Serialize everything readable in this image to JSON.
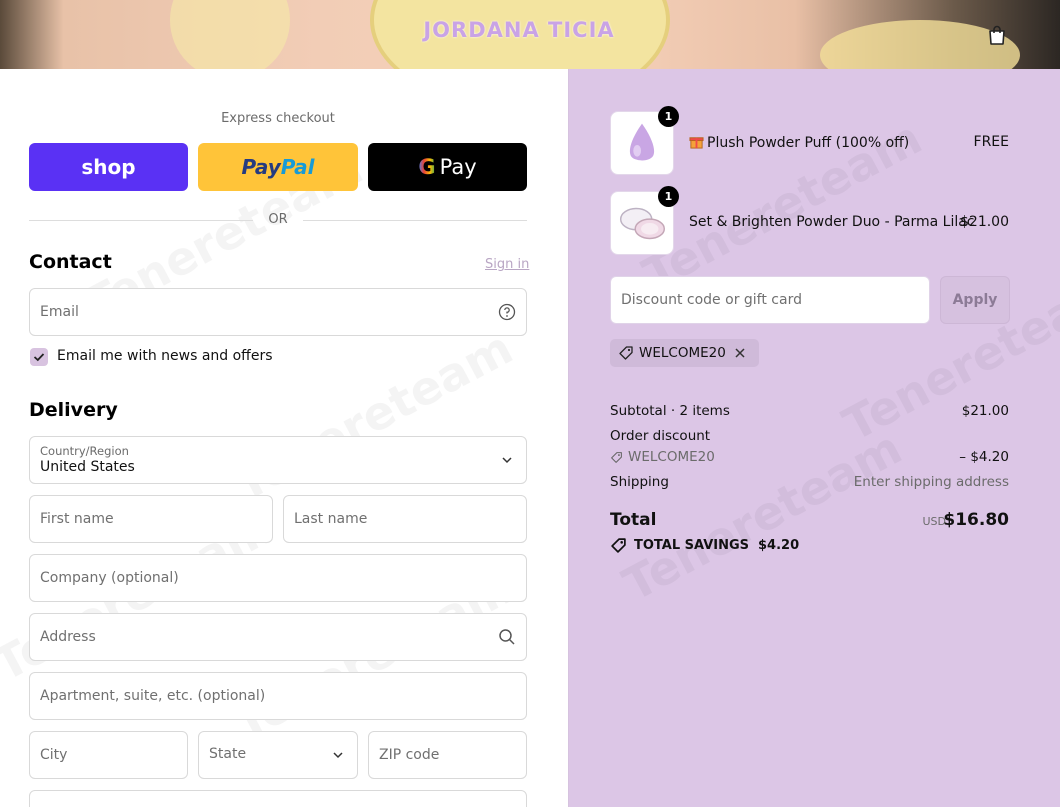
{
  "header": {
    "logo_text": "JORDANA TICIA",
    "cart_icon": "shopping-bag-icon"
  },
  "checkout": {
    "express_title": "Express checkout",
    "shop_label": "shop",
    "paypal_part1": "Pay",
    "paypal_part2": "Pal",
    "gpay_g": "G",
    "gpay_label": "Pay",
    "or_label": "OR",
    "contact_title": "Contact",
    "sign_in_label": "Sign in",
    "email_placeholder": "Email",
    "newsletter_label": "Email me with news and offers",
    "newsletter_checked": true,
    "delivery_title": "Delivery",
    "country_label": "Country/Region",
    "country_value": "United States",
    "first_name_placeholder": "First name",
    "last_name_placeholder": "Last name",
    "company_placeholder": "Company (optional)",
    "address_placeholder": "Address",
    "apartment_placeholder": "Apartment, suite, etc. (optional)",
    "city_placeholder": "City",
    "state_placeholder": "State",
    "zip_placeholder": "ZIP code"
  },
  "summary": {
    "items": [
      {
        "qty": "1",
        "name": "Plush Powder Puff (100% off)",
        "price": "FREE",
        "gift_icon": "gift-icon"
      },
      {
        "qty": "1",
        "name": "Set & Brighten Powder Duo - Parma Lilac",
        "price": "$21.00"
      }
    ],
    "discount_placeholder": "Discount code or gift card",
    "apply_label": "Apply",
    "applied_code": "WELCOME20",
    "subtotal_label": "Subtotal · 2 items",
    "subtotal_value": "$21.00",
    "order_discount_label": "Order discount",
    "order_discount_code": "WELCOME20",
    "order_discount_value": "– $4.20",
    "shipping_label": "Shipping",
    "shipping_value": "Enter shipping address",
    "total_label": "Total",
    "currency": "USD",
    "total_value": "$16.80",
    "savings_label": "TOTAL SAVINGS",
    "savings_value": "$4.20"
  },
  "watermark": "Tenereteam",
  "colors": {
    "shop_purple": "#5a31f4",
    "paypal_yellow": "#ffc439",
    "summary_bg": "#dcc6e6"
  }
}
